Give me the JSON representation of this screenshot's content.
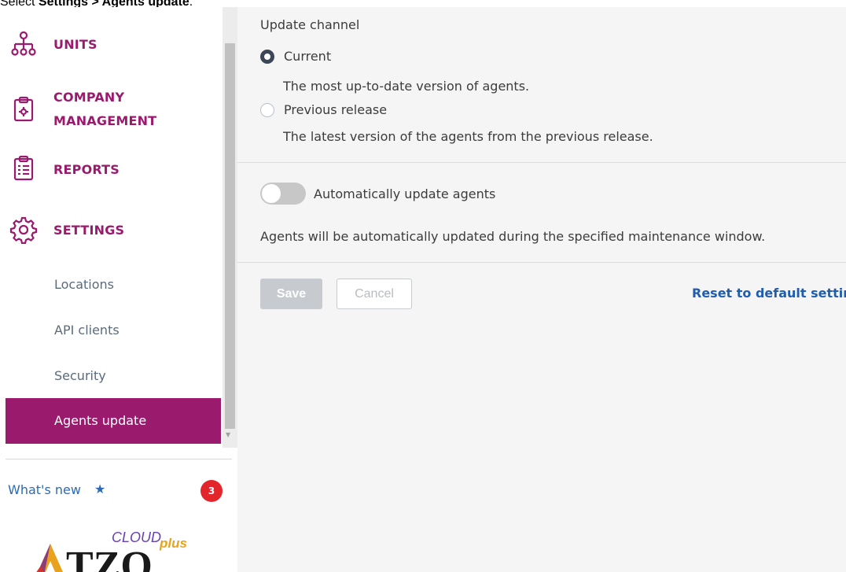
{
  "caption": {
    "prefix": "Select ",
    "bold": "Settings > Agents update",
    "suffix": "."
  },
  "sidebar": {
    "nav": [
      {
        "label": "UNITS",
        "icon": "org-chart-icon"
      },
      {
        "label_line1": "COMPANY",
        "label_line2": "MANAGEMENT",
        "icon": "clipboard-gear-icon"
      },
      {
        "label": "REPORTS",
        "icon": "report-clipboard-icon"
      },
      {
        "label": "SETTINGS",
        "icon": "gear-icon"
      }
    ],
    "sub_items": [
      "Locations",
      "API clients",
      "Security",
      "Agents update"
    ],
    "active_sub": "Agents update",
    "whats_new": "What's new",
    "whats_new_count": "3",
    "logo_text": "TZO",
    "logo_super": "CLOUDplus"
  },
  "main": {
    "update_channel_title": "Update channel",
    "options": [
      {
        "label": "Current",
        "description": "The most up-to-date version of agents.",
        "checked": true
      },
      {
        "label": "Previous release",
        "description": "The latest version of the agents from the previous release.",
        "checked": false
      }
    ],
    "auto_update_label": "Automatically update agents",
    "auto_update_enabled": false,
    "auto_update_description": "Agents will be automatically updated during the specified maintenance window.",
    "save_label": "Save",
    "cancel_label": "Cancel",
    "reset_label": "Reset to default settings"
  },
  "colors": {
    "accent": "#9a1a6e",
    "link": "#1f5db0",
    "badge": "#e3262c"
  }
}
